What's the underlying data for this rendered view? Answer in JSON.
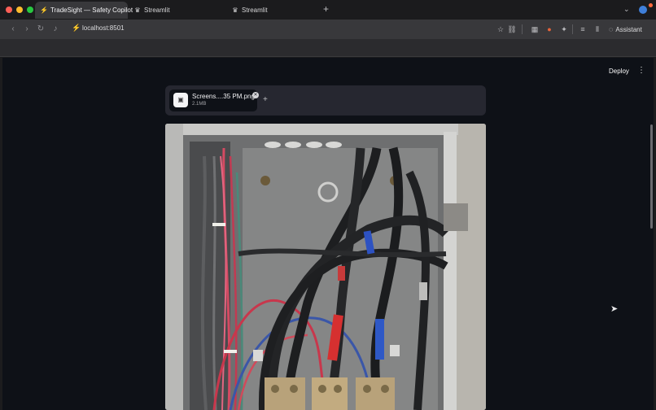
{
  "browser": {
    "tabs": [
      {
        "label": "TradeSight — Safety Copilot",
        "icon": "lightning-icon",
        "active": true
      },
      {
        "label": "Streamlit",
        "icon": "streamlit-crown-icon",
        "active": false
      },
      {
        "label": "Streamlit",
        "icon": "streamlit-crown-icon",
        "active": false
      }
    ],
    "new_tab_label": "+",
    "url": "localhost:8501",
    "assistant_label": "Assistant"
  },
  "app": {
    "deploy_label": "Deploy",
    "menu_glyph": "⋮",
    "uploaded_file": {
      "name": "Screens....35 PM.png",
      "size": "2.1MB"
    },
    "add_file_glyph": "+"
  },
  "colors": {
    "app_background": "#0e1117",
    "uploader_background": "#262730",
    "browser_toolbar": "#38383b"
  }
}
